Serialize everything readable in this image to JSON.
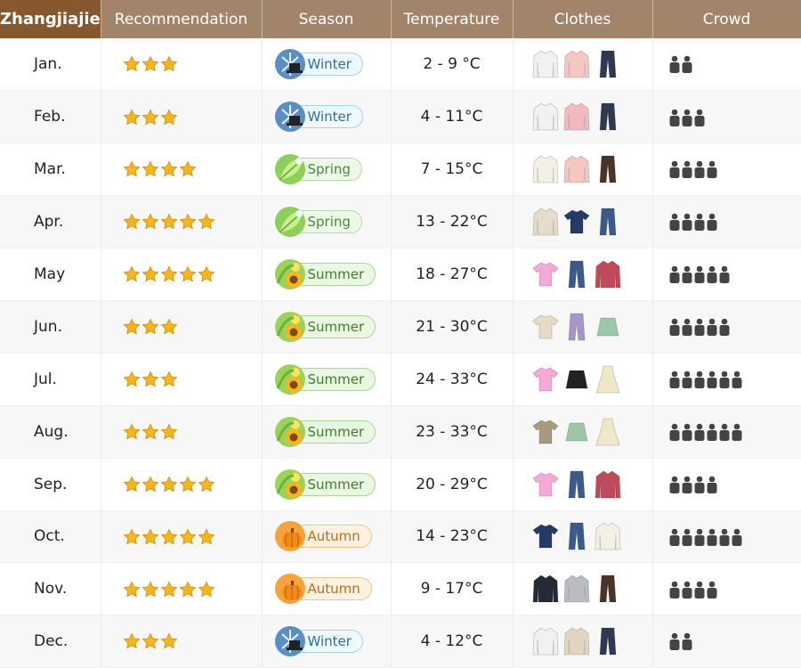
{
  "header": {
    "title": "Zhangjiajie",
    "columns": [
      "Recommendation",
      "Season",
      "Temperature",
      "Clothes",
      "Crowd"
    ]
  },
  "colors": {
    "header_bg": "#a2846b",
    "title_bg": "#87582f",
    "star": "#f7b51c",
    "crowd": "#444444"
  },
  "seasons": {
    "winter": {
      "label": "Winter",
      "icon": "winter-snowflake-icon"
    },
    "spring": {
      "label": "Spring",
      "icon": "spring-leaf-icon"
    },
    "summer": {
      "label": "Summer",
      "icon": "summer-sunflower-icon"
    },
    "autumn": {
      "label": "Autumn",
      "icon": "autumn-pumpkin-icon"
    }
  },
  "rows": [
    {
      "month": "Jan.",
      "stars": 3,
      "season": "winter",
      "temperature": "2 - 9 °C",
      "crowd": 2,
      "clothes": [
        "white-down-jacket",
        "pink-sweater",
        "dark-jeans"
      ]
    },
    {
      "month": "Feb.",
      "stars": 3,
      "season": "winter",
      "temperature": "4 - 11°C",
      "crowd": 3,
      "clothes": [
        "white-down-jacket",
        "pink-hoodie",
        "dark-jeans"
      ]
    },
    {
      "month": "Mar.",
      "stars": 4,
      "season": "spring",
      "temperature": "7 - 15°C",
      "crowd": 4,
      "clothes": [
        "white-jacket",
        "pink-sweater",
        "brown-pants"
      ]
    },
    {
      "month": "Apr.",
      "stars": 5,
      "season": "spring",
      "temperature": "13 - 22°C",
      "crowd": 4,
      "clothes": [
        "beige-trench-coat",
        "navy-sweatshirt",
        "blue-jeans"
      ]
    },
    {
      "month": "May",
      "stars": 5,
      "season": "summer",
      "temperature": "18 - 27°C",
      "crowd": 5,
      "clothes": [
        "pink-tshirt",
        "blue-jeans",
        "red-shirt"
      ]
    },
    {
      "month": "Jun.",
      "stars": 3,
      "season": "summer",
      "temperature": "21 - 30°C",
      "crowd": 5,
      "clothes": [
        "beige-polo",
        "purple-pants",
        "green-skirt"
      ]
    },
    {
      "month": "Jul.",
      "stars": 3,
      "season": "summer",
      "temperature": "24 - 33°C",
      "crowd": 6,
      "clothes": [
        "pink-tshirt",
        "black-shorts",
        "cream-dress"
      ]
    },
    {
      "month": "Aug.",
      "stars": 3,
      "season": "summer",
      "temperature": "23 - 33°C",
      "crowd": 6,
      "clothes": [
        "khaki-tshirt",
        "green-skirt",
        "cream-dress"
      ]
    },
    {
      "month": "Sep.",
      "stars": 5,
      "season": "summer",
      "temperature": "20 - 29°C",
      "crowd": 4,
      "clothes": [
        "pink-tshirt",
        "blue-jeans",
        "red-shirt"
      ]
    },
    {
      "month": "Oct.",
      "stars": 5,
      "season": "autumn",
      "temperature": "14 - 23°C",
      "crowd": 6,
      "clothes": [
        "navy-sweatshirt",
        "blue-jeans",
        "white-jacket"
      ]
    },
    {
      "month": "Nov.",
      "stars": 5,
      "season": "autumn",
      "temperature": "9 - 17°C",
      "crowd": 4,
      "clothes": [
        "black-puffer-jacket",
        "grey-hoodie",
        "brown-pants"
      ]
    },
    {
      "month": "Dec.",
      "stars": 3,
      "season": "winter",
      "temperature": "4 - 12°C",
      "crowd": 2,
      "clothes": [
        "white-down-jacket",
        "beige-sweater",
        "dark-jeans"
      ]
    }
  ]
}
